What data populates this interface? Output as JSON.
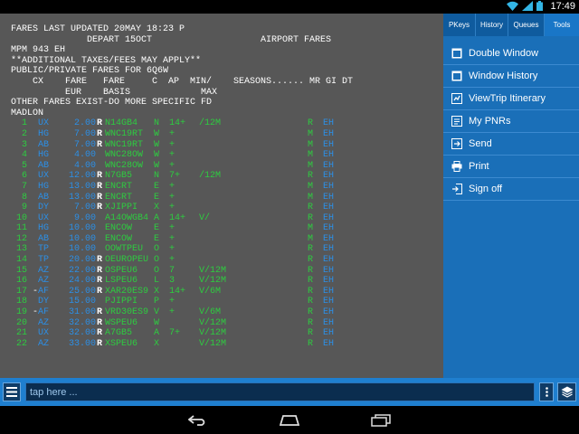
{
  "status_bar": {
    "time": "17:49",
    "icons": [
      "wifi-icon",
      "signal-icon",
      "battery-icon"
    ]
  },
  "terminal": {
    "header_lines": [
      "FARES LAST UPDATED 20MAY 18:23 P",
      "              DEPART 15OCT                    AIRPORT FARES",
      "MPM 943 EH",
      "**ADDITIONAL TAXES/FEES MAY APPLY**",
      "PUBLIC/PRIVATE FARES FOR 6Q6W",
      "    CX    FARE   FARE     C  AP  MIN/    SEASONS...... MR GI DT",
      "          EUR    BASIS             MAX",
      "OTHER FARES EXIST-DO MORE SPECIFIC FD",
      "MADLON"
    ],
    "fare_rows": [
      {
        "num": "1",
        "dash": "",
        "cx": "UX",
        "fare": "2.00",
        "r": "R",
        "basis": "N14GB4",
        "c": "N",
        "ap": "14+",
        "minmax": "/12M",
        "mr": "R",
        "gi": "EH"
      },
      {
        "num": "2",
        "dash": "",
        "cx": "HG",
        "fare": "7.00",
        "r": "R",
        "basis": "WNC19RT",
        "c": "W",
        "ap": "+",
        "minmax": "",
        "mr": "M",
        "gi": "EH"
      },
      {
        "num": "3",
        "dash": "",
        "cx": "AB",
        "fare": "7.00",
        "r": "R",
        "basis": "WNC19RT",
        "c": "W",
        "ap": "+",
        "minmax": "",
        "mr": "M",
        "gi": "EH"
      },
      {
        "num": "4",
        "dash": "",
        "cx": "HG",
        "fare": "4.00",
        "r": "",
        "basis": "WNC28OW",
        "c": "W",
        "ap": "+",
        "minmax": "",
        "mr": "M",
        "gi": "EH"
      },
      {
        "num": "5",
        "dash": "",
        "cx": "AB",
        "fare": "4.00",
        "r": "",
        "basis": "WNC28OW",
        "c": "W",
        "ap": "+",
        "minmax": "",
        "mr": "M",
        "gi": "EH"
      },
      {
        "num": "6",
        "dash": "",
        "cx": "UX",
        "fare": "12.00",
        "r": "R",
        "basis": "N7GB5",
        "c": "N",
        "ap": "7+",
        "minmax": "/12M",
        "mr": "R",
        "gi": "EH"
      },
      {
        "num": "7",
        "dash": "",
        "cx": "HG",
        "fare": "13.00",
        "r": "R",
        "basis": "ENCRT",
        "c": "E",
        "ap": "+",
        "minmax": "",
        "mr": "M",
        "gi": "EH"
      },
      {
        "num": "8",
        "dash": "",
        "cx": "AB",
        "fare": "13.00",
        "r": "R",
        "basis": "ENCRT",
        "c": "E",
        "ap": "+",
        "minmax": "",
        "mr": "M",
        "gi": "EH"
      },
      {
        "num": "9",
        "dash": "",
        "cx": "DY",
        "fare": "7.00",
        "r": "R",
        "basis": "XJIPPI",
        "c": "X",
        "ap": "+",
        "minmax": "",
        "mr": "R",
        "gi": "EH"
      },
      {
        "num": "10",
        "dash": "",
        "cx": "UX",
        "fare": "9.00",
        "r": "",
        "basis": "A14OWGB4",
        "c": "A",
        "ap": "14+",
        "minmax": "V/",
        "mr": "R",
        "gi": "EH"
      },
      {
        "num": "11",
        "dash": "",
        "cx": "HG",
        "fare": "10.00",
        "r": "",
        "basis": "ENCOW",
        "c": "E",
        "ap": "+",
        "minmax": "",
        "mr": "M",
        "gi": "EH"
      },
      {
        "num": "12",
        "dash": "",
        "cx": "AB",
        "fare": "10.00",
        "r": "",
        "basis": "ENCOW",
        "c": "E",
        "ap": "+",
        "minmax": "",
        "mr": "M",
        "gi": "EH"
      },
      {
        "num": "13",
        "dash": "",
        "cx": "TP",
        "fare": "10.00",
        "r": "",
        "basis": "OOWTPEU",
        "c": "O",
        "ap": "+",
        "minmax": "",
        "mr": "R",
        "gi": "EH"
      },
      {
        "num": "14",
        "dash": "",
        "cx": "TP",
        "fare": "20.00",
        "r": "R",
        "basis": "OEUROPEU",
        "c": "O",
        "ap": "+",
        "minmax": "",
        "mr": "R",
        "gi": "EH"
      },
      {
        "num": "15",
        "dash": "",
        "cx": "AZ",
        "fare": "22.00",
        "r": "R",
        "basis": "OSPEU6",
        "c": "O",
        "ap": "7",
        "minmax": "V/12M",
        "mr": "R",
        "gi": "EH"
      },
      {
        "num": "16",
        "dash": "",
        "cx": "AZ",
        "fare": "24.00",
        "r": "R",
        "basis": "LSPEU6",
        "c": "L",
        "ap": "3",
        "minmax": "V/12M",
        "mr": "R",
        "gi": "EH"
      },
      {
        "num": "17",
        "dash": "-",
        "cx": "AF",
        "fare": "25.00",
        "r": "R",
        "basis": "XAR20ES9",
        "c": "X",
        "ap": "14+",
        "minmax": "V/6M",
        "mr": "R",
        "gi": "EH"
      },
      {
        "num": "18",
        "dash": "",
        "cx": "DY",
        "fare": "15.00",
        "r": "",
        "basis": "PJIPPI",
        "c": "P",
        "ap": "+",
        "minmax": "",
        "mr": "R",
        "gi": "EH"
      },
      {
        "num": "19",
        "dash": "-",
        "cx": "AF",
        "fare": "31.00",
        "r": "R",
        "basis": "VRD30ES9",
        "c": "V",
        "ap": "+",
        "minmax": "V/6M",
        "mr": "R",
        "gi": "EH"
      },
      {
        "num": "20",
        "dash": "",
        "cx": "AZ",
        "fare": "32.00",
        "r": "R",
        "basis": "WSPEU6",
        "c": "W",
        "ap": "",
        "minmax": "V/12M",
        "mr": "R",
        "gi": "EH"
      },
      {
        "num": "21",
        "dash": "",
        "cx": "UX",
        "fare": "32.00",
        "r": "R",
        "basis": "A7GB5",
        "c": "A",
        "ap": "7+",
        "minmax": "V/12M",
        "mr": "R",
        "gi": "EH"
      },
      {
        "num": "22",
        "dash": "",
        "cx": "AZ",
        "fare": "33.00",
        "r": "R",
        "basis": "XSPEU6",
        "c": "X",
        "ap": "",
        "minmax": "V/12M",
        "mr": "R",
        "gi": "EH"
      }
    ]
  },
  "side_panel": {
    "tabs": [
      {
        "label": "PKeys",
        "active": false
      },
      {
        "label": "History",
        "active": false
      },
      {
        "label": "Queues",
        "active": false
      },
      {
        "label": "Tools",
        "active": true
      }
    ],
    "menu": [
      {
        "label": "Double Window",
        "icon": "window-icon"
      },
      {
        "label": "Window History",
        "icon": "window-history-icon"
      },
      {
        "label": "ViewTrip Itinerary",
        "icon": "itinerary-icon"
      },
      {
        "label": "My PNRs",
        "icon": "pnr-list-icon"
      },
      {
        "label": "Send",
        "icon": "send-icon"
      },
      {
        "label": "Print",
        "icon": "print-icon"
      },
      {
        "label": "Sign off",
        "icon": "sign-off-icon"
      }
    ]
  },
  "input_bar": {
    "placeholder": "tap here ...",
    "value": ""
  },
  "colors": {
    "terminal_bg": "#575757",
    "panel_blue": "#1a6fb8",
    "green_text": "#2ecc40",
    "blue_text": "#2c8fe6"
  }
}
